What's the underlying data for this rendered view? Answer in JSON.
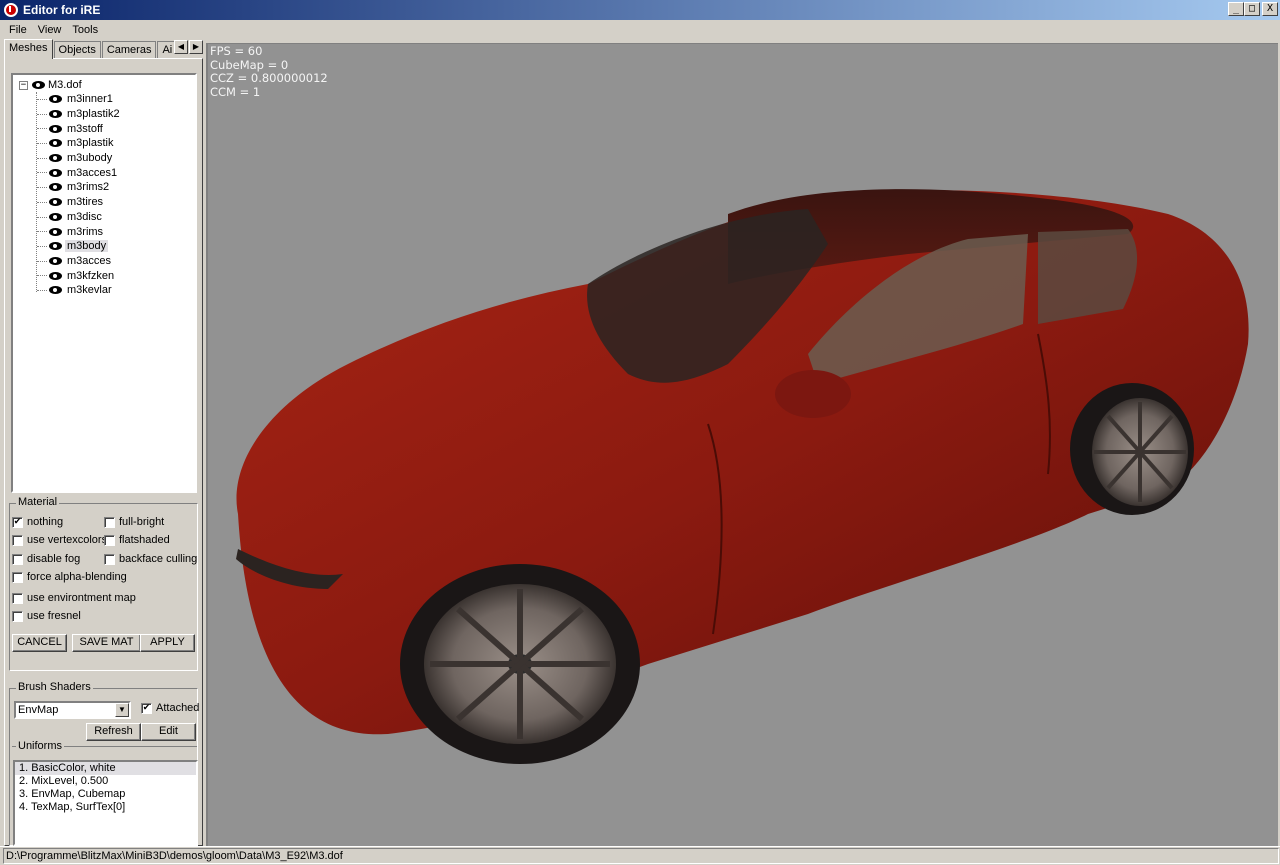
{
  "window": {
    "title": "Editor for iRE",
    "minimize": "_",
    "maximize": "□",
    "close": "X"
  },
  "menu": [
    "File",
    "View",
    "Tools"
  ],
  "tabs": [
    "Meshes",
    "Objects",
    "Cameras",
    "Ai"
  ],
  "tree": {
    "root": "M3.dof",
    "items": [
      "m3inner1",
      "m3plastik2",
      "m3stoff",
      "m3plastik",
      "m3ubody",
      "m3acces1",
      "m3rims2",
      "m3tires",
      "m3disc",
      "m3rims",
      "m3body",
      "m3acces",
      "m3kfzken",
      "m3kevlar"
    ],
    "selected": "m3body"
  },
  "material": {
    "legend": "Material",
    "nothing": {
      "label": "nothing",
      "checked": true
    },
    "full_bright": {
      "label": "full-bright",
      "checked": false
    },
    "use_vertexcolors": {
      "label": "use vertexcolors",
      "checked": false
    },
    "flatshaded": {
      "label": "flatshaded",
      "checked": false
    },
    "disable_fog": {
      "label": "disable fog",
      "checked": false
    },
    "backface_culling": {
      "label": "backface culling",
      "checked": false
    },
    "force_alpha": {
      "label": "force alpha-blending",
      "checked": false
    },
    "use_envmap": {
      "label": "use environtment map",
      "checked": false
    },
    "use_fresnel": {
      "label": "use fresnel",
      "checked": false
    },
    "cancel": "CANCEL",
    "save": "SAVE MAT",
    "apply": "APPLY"
  },
  "brush": {
    "legend": "Brush Shaders",
    "shader": "EnvMap",
    "attached": {
      "label": "Attached",
      "checked": true
    },
    "refresh": "Refresh",
    "edit": "Edit",
    "uniforms_label": "Uniforms",
    "uniforms": [
      "1. BasicColor, white",
      "2. MixLevel, 0.500",
      "3. EnvMap, Cubemap",
      "4. TexMap, SurfTex[0]"
    ],
    "selected_uniform": 0
  },
  "hud": [
    "FPS = 60",
    "CubeMap = 0",
    "CCZ = 0.800000012",
    "CCM = 1"
  ],
  "status": "D:\\Programme\\BlitzMax\\MiniB3D\\demos\\gloom\\Data\\M3_E92\\M3.dof",
  "colors": {
    "title_start": "#0a246a",
    "title_end": "#a6caf0",
    "viewport_bg": "#929292",
    "car_body": "#8b1a10"
  }
}
